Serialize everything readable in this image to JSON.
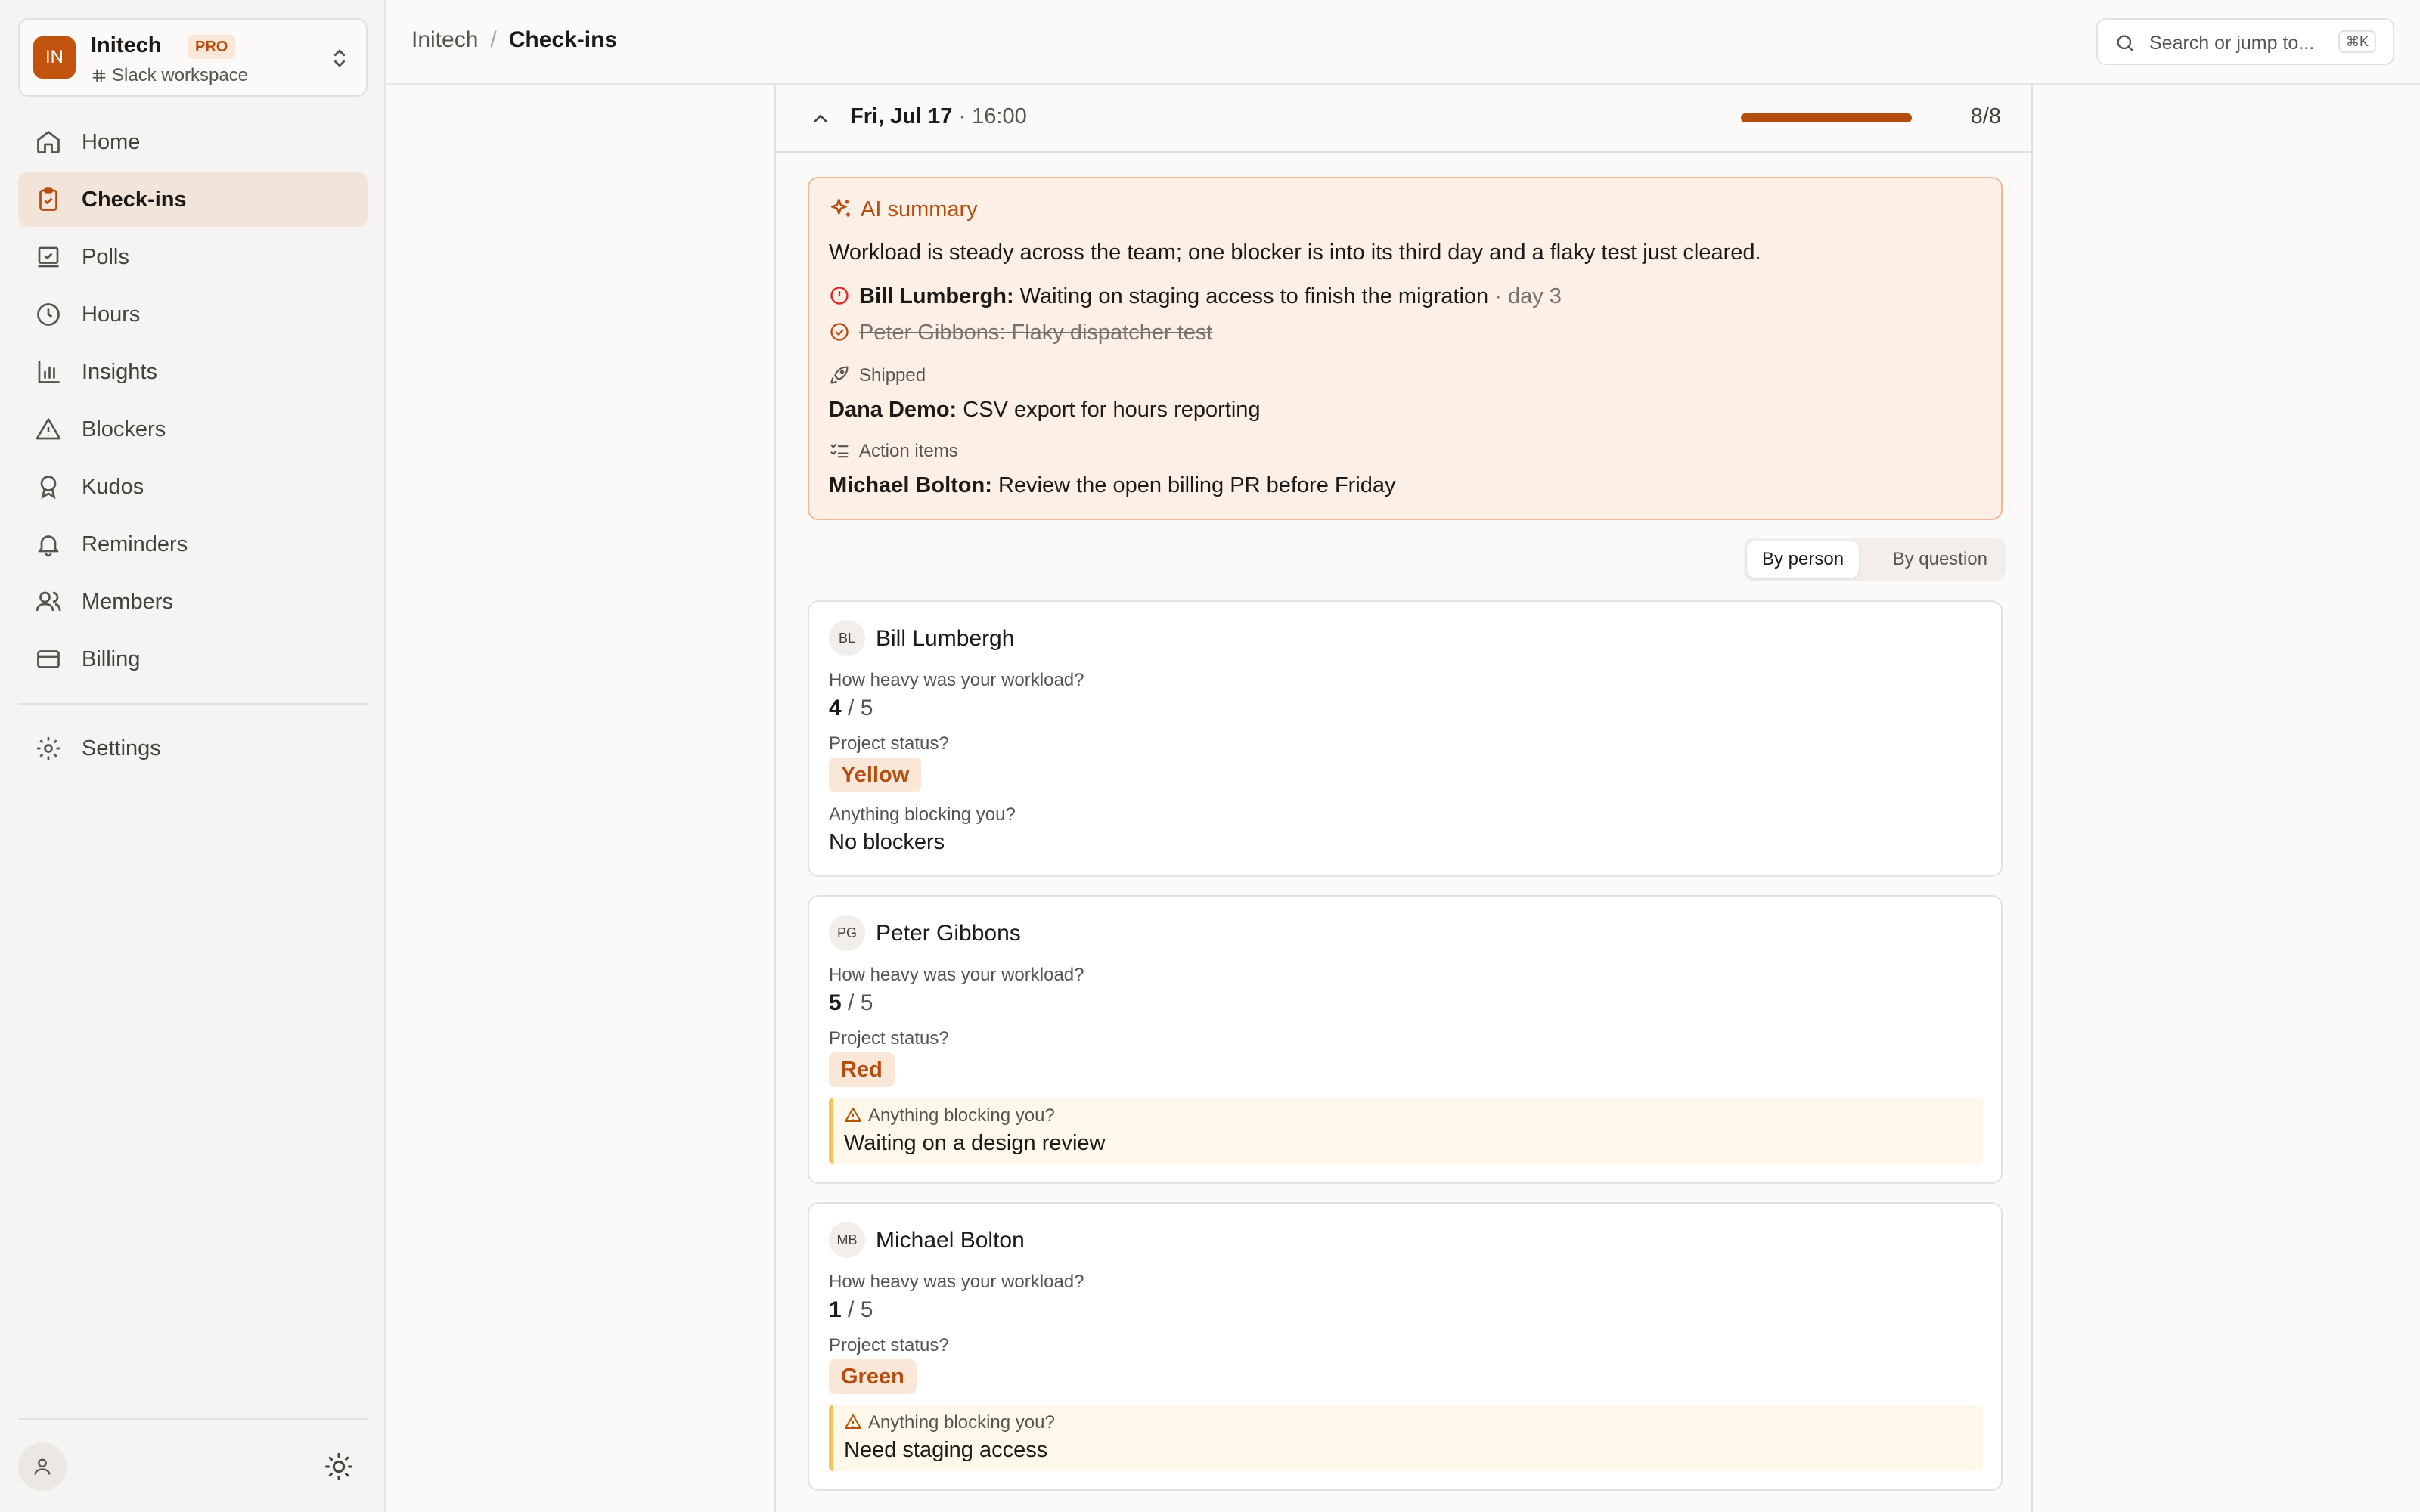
{
  "workspace": {
    "initials": "IN",
    "name": "Initech",
    "plan_badge": "PRO",
    "subtitle": "Slack workspace"
  },
  "sidebar": {
    "items": [
      {
        "label": "Home",
        "icon": "home-icon"
      },
      {
        "label": "Check-ins",
        "icon": "clipboard-icon",
        "active": true
      },
      {
        "label": "Polls",
        "icon": "poll-icon"
      },
      {
        "label": "Hours",
        "icon": "clock-icon"
      },
      {
        "label": "Insights",
        "icon": "bar-chart-icon"
      },
      {
        "label": "Blockers",
        "icon": "warning-icon"
      },
      {
        "label": "Kudos",
        "icon": "award-icon"
      },
      {
        "label": "Reminders",
        "icon": "bell-icon"
      },
      {
        "label": "Members",
        "icon": "users-icon"
      },
      {
        "label": "Billing",
        "icon": "credit-card-icon"
      }
    ],
    "settings_label": "Settings"
  },
  "breadcrumb": {
    "root": "Initech",
    "current": "Check-ins"
  },
  "search": {
    "placeholder": "Search or jump to...",
    "shortcut": "⌘K"
  },
  "run": {
    "date": "Fri, Jul 17",
    "time": " · 16:00",
    "responded": 8,
    "total": 8,
    "count_label": "8/8"
  },
  "ai_summary": {
    "title": "AI summary",
    "text": "Workload is steady across the team; one blocker is into its third day and a flaky test just cleared.",
    "blocker_open": {
      "person": "Bill Lumbergh:",
      "text": " Waiting on staging access to finish the migration",
      "age": " · day 3"
    },
    "blocker_resolved": {
      "text": "Peter Gibbons: Flaky dispatcher test"
    },
    "shipped_label": "Shipped",
    "shipped": {
      "person": "Dana Demo:",
      "text": " CSV export for hours reporting"
    },
    "action_label": "Action items",
    "action": {
      "person": "Michael Bolton:",
      "text": " Review the open billing PR before Friday"
    }
  },
  "view_toggle": {
    "by_person": "By person",
    "by_question": "By question"
  },
  "questions": {
    "workload": "How heavy was your workload?",
    "status": "Project status?",
    "blocking": "Anything blocking you?"
  },
  "responses": [
    {
      "initials": "BL",
      "name": "Bill Lumbergh",
      "workload": "4",
      "workload_of": " / 5",
      "status": "Yellow",
      "blocker": "No blockers"
    },
    {
      "initials": "PG",
      "name": "Peter Gibbons",
      "workload": "5",
      "workload_of": " / 5",
      "status": "Red",
      "blocker": "Waiting on a design review"
    },
    {
      "initials": "MB",
      "name": "Michael Bolton",
      "workload": "1",
      "workload_of": " / 5",
      "status": "Green",
      "blocker": "Need staging access"
    }
  ],
  "colors": {
    "accent": "#b44d10",
    "accent_bg": "#fbe7d8",
    "summary_bg": "#fcefe6",
    "blocker_bar": "#f5c15a"
  }
}
